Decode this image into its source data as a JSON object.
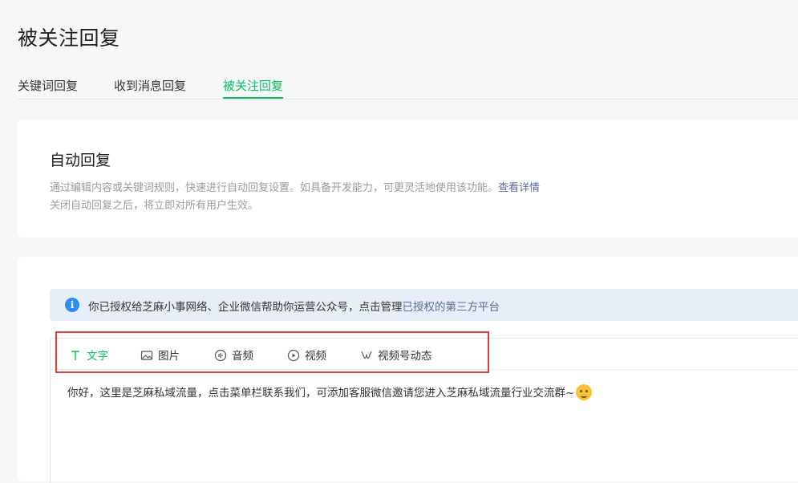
{
  "page": {
    "title": "被关注回复"
  },
  "tabs": [
    {
      "label": "关键词回复"
    },
    {
      "label": "收到消息回复"
    },
    {
      "label": "被关注回复",
      "active": true
    }
  ],
  "info_card": {
    "title": "自动回复",
    "desc_line1": "通过编辑内容或关键词规则，快速进行自动回复设置。如具备开发能力，可更灵活地使用该功能。",
    "desc_link": "查看详情",
    "desc_line2": "关闭自动回复之后，将立即对所有用户生效。"
  },
  "notice": {
    "icon": "info-icon",
    "text": "你已授权给芝麻小事网络、企业微信帮助你运营公众号，点击管理",
    "link": "已授权的第三方平台"
  },
  "toolbar": {
    "items": [
      {
        "label": "文字",
        "icon": "text-icon",
        "active": true
      },
      {
        "label": "图片",
        "icon": "image-icon"
      },
      {
        "label": "音频",
        "icon": "audio-icon"
      },
      {
        "label": "视频",
        "icon": "video-icon"
      },
      {
        "label": "视频号动态",
        "icon": "channels-icon"
      }
    ]
  },
  "editor": {
    "content": "你好，这里是芝麻私域流量，点击菜单栏联系我们，可添加客服微信邀请您进入芝麻私域流量行业交流群~",
    "emoji": "smiling-face-emoji"
  },
  "colors": {
    "accent": "#07c160",
    "link": "#576b95",
    "annotation": "#e23d3d",
    "notice_bg": "#e8eef8"
  }
}
